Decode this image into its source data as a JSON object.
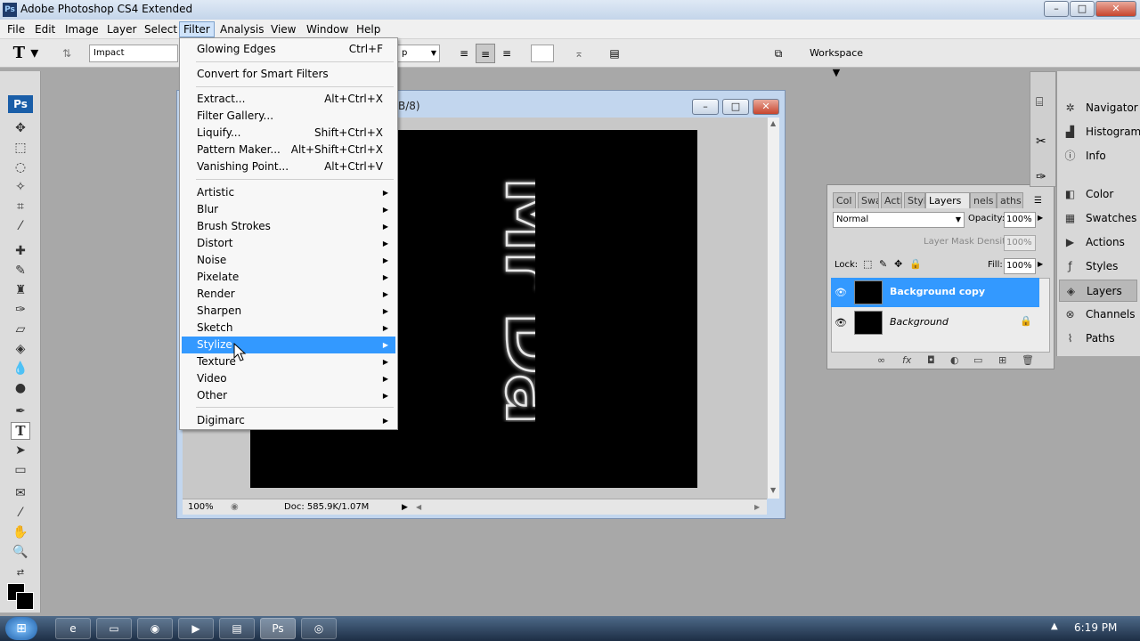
{
  "window": {
    "title": "Adobe Photoshop CS4 Extended",
    "icon_text": "Ps"
  },
  "menubar": [
    "File",
    "Edit",
    "Image",
    "Layer",
    "Select",
    "Filter",
    "Analysis",
    "View",
    "Window",
    "Help"
  ],
  "options": {
    "font_family": "Impact",
    "font_style": "p",
    "workspace_label": "Workspace ▼"
  },
  "tools": {
    "logo": "Ps"
  },
  "filter_menu": {
    "items": [
      {
        "label": "Glowing Edges",
        "shortcut": "Ctrl+F"
      },
      {
        "label": "Convert for Smart Filters",
        "shortcut": ""
      },
      {
        "label": "Extract...",
        "shortcut": "Alt+Ctrl+X"
      },
      {
        "label": "Filter Gallery...",
        "shortcut": ""
      },
      {
        "label": "Liquify...",
        "shortcut": "Shift+Ctrl+X"
      },
      {
        "label": "Pattern Maker...",
        "shortcut": "Alt+Shift+Ctrl+X"
      },
      {
        "label": "Vanishing Point...",
        "shortcut": "Alt+Ctrl+V"
      },
      {
        "label": "Artistic"
      },
      {
        "label": "Blur"
      },
      {
        "label": "Brush Strokes"
      },
      {
        "label": "Distort"
      },
      {
        "label": "Noise"
      },
      {
        "label": "Pixelate"
      },
      {
        "label": "Render"
      },
      {
        "label": "Sharpen"
      },
      {
        "label": "Sketch"
      },
      {
        "label": "Stylize"
      },
      {
        "label": "Texture"
      },
      {
        "label": "Video"
      },
      {
        "label": "Other"
      },
      {
        "label": "Digimarc"
      }
    ],
    "highlighted": "Stylize"
  },
  "document": {
    "title_fragment": "B/8)",
    "zoom": "100%",
    "doc_info": "Doc: 585.9K/1.07M",
    "canvas_text": "Mr Dai"
  },
  "layers_panel": {
    "tabs": [
      "Col",
      "Swa",
      "Acti",
      "Styl",
      "Layers ×",
      "nels",
      "aths"
    ],
    "blend_mode": "Normal",
    "opacity_label": "Opacity:",
    "opacity_value": "100%",
    "mask_density_label": "Layer Mask Density",
    "mask_density_value": "100%",
    "lock_label": "Lock:",
    "fill_label": "Fill:",
    "fill_value": "100%",
    "layers": [
      {
        "name": "Background copy",
        "selected": true
      },
      {
        "name": "Background",
        "selected": false
      }
    ]
  },
  "dock": {
    "items": [
      "Navigator",
      "Histogram",
      "Info",
      "Color",
      "Swatches",
      "Actions",
      "Styles",
      "Layers",
      "Channels",
      "Paths"
    ],
    "selected": "Layers"
  },
  "taskbar": {
    "clock": "6:19 PM"
  },
  "colors": {
    "highlight": "#3399ff",
    "canvas_bg": "#000000"
  }
}
